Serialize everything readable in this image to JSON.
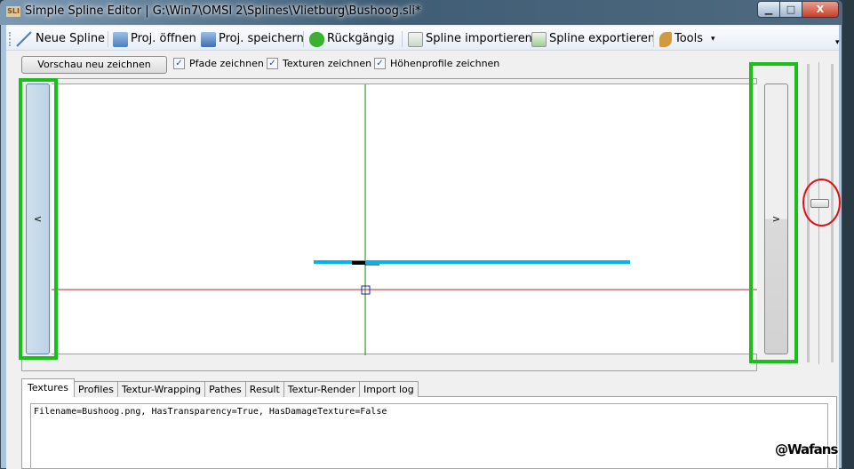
{
  "window": {
    "title": "Simple Spline Editor | G:\\Win7\\OMSI 2\\Splines\\Vlietburg\\Bushoog.sli*",
    "icon_text": "SLI",
    "minimize": "▁",
    "maximize": "□",
    "close": "X"
  },
  "toolbar": {
    "items": [
      {
        "label": "Neue Spline",
        "icon": "line-icon"
      },
      {
        "label": "Proj. öffnen",
        "icon": "open-project-icon"
      },
      {
        "label": "Proj. speichern",
        "icon": "save-project-icon"
      },
      {
        "label": "Rückgängig",
        "icon": "undo-icon"
      },
      {
        "label": "Spline importieren",
        "icon": "import-icon"
      },
      {
        "label": "Spline exportieren",
        "icon": "export-icon"
      },
      {
        "label": "Tools",
        "icon": "wrench-icon"
      }
    ],
    "dropdown_arrow": "▾",
    "overflow": "▾"
  },
  "options": {
    "preview_button": "Vorschau neu zeichnen",
    "checkboxes": [
      {
        "label": "Pfade zeichnen",
        "checked": true
      },
      {
        "label": "Texturen zeichnen",
        "checked": true
      },
      {
        "label": "Höhenprofile zeichnen",
        "checked": true
      }
    ],
    "check_glyph": "✓"
  },
  "canvas": {
    "left_button": "<",
    "right_button": ">",
    "zoom_slider_value": 0.5
  },
  "colors": {
    "highlight_green": "#18c018",
    "circle_red": "#e01010",
    "spline_blue": "#00b4f0",
    "axis_x": "#c02020",
    "axis_y": "#108010"
  },
  "tabs": {
    "items": [
      "Textures",
      "Profiles",
      "Textur-Wrapping",
      "Pathes",
      "Result",
      "Textur-Render",
      "Import log"
    ],
    "active": 0
  },
  "textures": {
    "content": "Filename=Bushoog.png, HasTransparency=True, HasDamageTexture=False"
  },
  "watermark": "@Wafans"
}
